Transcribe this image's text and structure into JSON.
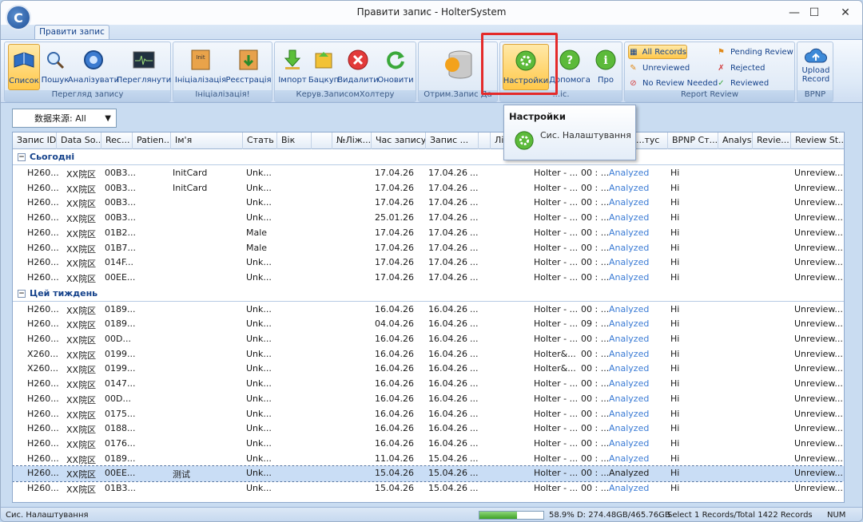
{
  "window": {
    "title": "Правити запис - HolterSystem",
    "minimize": "—",
    "maximize": "☐",
    "close": "✕"
  },
  "ribbon_tab": "Правити запис",
  "groups": {
    "g1": "Перегляд запису",
    "g2": "Ініціалізація!",
    "g3": "Керув.ЗаписомХолтеру",
    "g4": "Отрим.Запис Да",
    "g5": "...іс.",
    "g6": "Report Review",
    "g7": "BPNP"
  },
  "buttons": {
    "list": "Список",
    "search": "Пошук",
    "analyze": "Аналізувати",
    "view": "Переглянути",
    "init": "Ініціалізація",
    "register": "Реєстрація",
    "import": "Імпорт",
    "backup": "Бацкуп",
    "delete": "Видалити",
    "refresh": "Оновити",
    "settings": "Настройки",
    "help": "Допомога",
    "about": "Про",
    "all_records": "All Records",
    "unreviewed": "Unreviewed",
    "no_review": "No Review Needed",
    "pending": "Pending Review",
    "rejected": "Rejected",
    "reviewed": "Reviewed",
    "upload": "Upload",
    "upload2": "Record"
  },
  "filter": {
    "label": "数据来源: All"
  },
  "columns": [
    "Запис ID",
    "Data So...",
    "Rec...",
    "Patien...",
    "Ім'я",
    "Стать",
    "Вік",
    "",
    "№Ліж...",
    "Час запису",
    "Запис ...",
    "",
    "Лі",
    "",
    "...тус",
    "BPNP Ст...",
    "Analyst",
    "Revie...",
    "Review St..."
  ],
  "groups_rows": {
    "today": "Сьогодні",
    "week": "Цей тиждень"
  },
  "rows_today": [
    [
      "H260...",
      "XX院区",
      "00B3...",
      "",
      "InitCard",
      "Unk...",
      "17.04.26",
      "17.04.26",
      "Holter - ...",
      "00 : ...",
      "Analyzed",
      "Hi",
      "Unreview..."
    ],
    [
      "H260...",
      "XX院区",
      "00B3...",
      "",
      "InitCard",
      "Unk...",
      "17.04.26",
      "17.04.26",
      "Holter - ...",
      "00 : ...",
      "Analyzed",
      "Hi",
      "Unreview..."
    ],
    [
      "H260...",
      "XX院区",
      "00B3...",
      "",
      "",
      "Unk...",
      "17.04.26",
      "17.04.26",
      "Holter - ...",
      "00 : ...",
      "Analyzed",
      "Hi",
      "Unreview..."
    ],
    [
      "H260...",
      "XX院区",
      "00B3...",
      "",
      "",
      "Unk...",
      "25.01.26",
      "17.04.26",
      "Holter - ...",
      "00 : ...",
      "Analyzed",
      "Hi",
      "Unreview..."
    ],
    [
      "H260...",
      "XX院区",
      "01B2...",
      "",
      "",
      "Male",
      "17.04.26",
      "17.04.26",
      "Holter - ...",
      "00 : ...",
      "Analyzed",
      "Hi",
      "Unreview..."
    ],
    [
      "H260...",
      "XX院区",
      "01B7...",
      "",
      "",
      "Male",
      "17.04.26",
      "17.04.26",
      "Holter - ...",
      "00 : ...",
      "Analyzed",
      "Hi",
      "Unreview..."
    ],
    [
      "H260...",
      "XX院区",
      "014F...",
      "",
      "",
      "Unk...",
      "17.04.26",
      "17.04.26",
      "Holter - ...",
      "00 : ...",
      "Analyzed",
      "Hi",
      "Unreview..."
    ],
    [
      "H260...",
      "XX院区",
      "00EE...",
      "",
      "",
      "Unk...",
      "17.04.26",
      "17.04.26",
      "Holter - ...",
      "00 : ...",
      "Analyzed",
      "Hi",
      "Unreview..."
    ]
  ],
  "rows_week": [
    [
      "H260...",
      "XX院区",
      "0189...",
      "",
      "",
      "Unk...",
      "16.04.26",
      "16.04.26",
      "Holter - ...",
      "00 : ...",
      "Analyzed",
      "Hi",
      "Unreview..."
    ],
    [
      "H260...",
      "XX院区",
      "0189...",
      "",
      "",
      "Unk...",
      "04.04.26",
      "16.04.26",
      "Holter - ...",
      "09 : ...",
      "Analyzed",
      "Hi",
      "Unreview..."
    ],
    [
      "H260...",
      "XX院区",
      "00D...",
      "",
      "",
      "Unk...",
      "16.04.26",
      "16.04.26",
      "Holter - ...",
      "00 : ...",
      "Analyzed",
      "Hi",
      "Unreview..."
    ],
    [
      "X260...",
      "XX院区",
      "0199...",
      "",
      "",
      "Unk...",
      "16.04.26",
      "16.04.26",
      "Holter&...",
      "00 : ...",
      "Analyzed",
      "Hi",
      "Unreview..."
    ],
    [
      "X260...",
      "XX院区",
      "0199...",
      "",
      "",
      "Unk...",
      "16.04.26",
      "16.04.26",
      "Holter&...",
      "00 : ...",
      "Analyzed",
      "Hi",
      "Unreview..."
    ],
    [
      "H260...",
      "XX院区",
      "0147...",
      "",
      "",
      "Unk...",
      "16.04.26",
      "16.04.26",
      "Holter - ...",
      "00 : ...",
      "Analyzed",
      "Hi",
      "Unreview..."
    ],
    [
      "H260...",
      "XX院区",
      "00D...",
      "",
      "",
      "Unk...",
      "16.04.26",
      "16.04.26",
      "Holter - ...",
      "00 : ...",
      "Analyzed",
      "Hi",
      "Unreview..."
    ],
    [
      "H260...",
      "XX院区",
      "0175...",
      "",
      "",
      "Unk...",
      "16.04.26",
      "16.04.26",
      "Holter - ...",
      "00 : ...",
      "Analyzed",
      "Hi",
      "Unreview..."
    ],
    [
      "H260...",
      "XX院区",
      "0188...",
      "",
      "",
      "Unk...",
      "16.04.26",
      "16.04.26",
      "Holter - ...",
      "00 : ...",
      "Analyzed",
      "Hi",
      "Unreview..."
    ],
    [
      "H260...",
      "XX院区",
      "0176...",
      "",
      "",
      "Unk...",
      "16.04.26",
      "16.04.26",
      "Holter - ...",
      "00 : ...",
      "Analyzed",
      "Hi",
      "Unreview..."
    ],
    [
      "H260...",
      "XX院区",
      "0189...",
      "",
      "",
      "Unk...",
      "11.04.26",
      "15.04.26",
      "Holter - ...",
      "00 : ...",
      "Analyzed",
      "Hi",
      "Unreview..."
    ],
    [
      "H260...",
      "XX院区",
      "00EE...",
      "",
      "测试",
      "Unk...",
      "15.04.26",
      "15.04.26",
      "Holter - ...",
      "00 : ...",
      "Analyzed",
      "Hi",
      "Unreview..."
    ],
    [
      "H260...",
      "XX院区",
      "01B3...",
      "",
      "",
      "Unk...",
      "15.04.26",
      "15.04.26",
      "Holter - ...",
      "00 : ...",
      "Analyzed",
      "Hi",
      "Unreview..."
    ]
  ],
  "tooltip": {
    "title": "Настройки",
    "desc": "Сис. Налаштування"
  },
  "status": {
    "left": "Сис. Налаштування",
    "disk": "58.9%  D: 274.48GB/465.76GB",
    "disk_pct": 58.9,
    "records": "Select 1 Records/Total 1422 Records",
    "num": "NUM"
  },
  "colors": {
    "accent": "#15428b",
    "link": "#3a7bd5",
    "highlight": "#e42a2a"
  }
}
